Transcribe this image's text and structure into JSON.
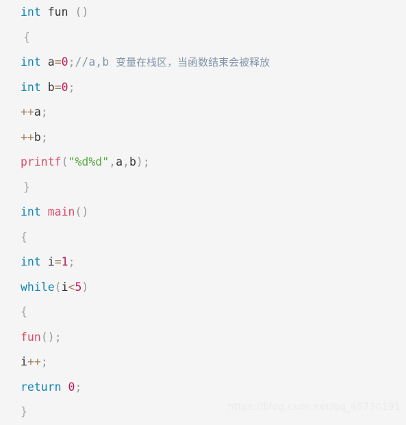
{
  "editor": {
    "background_color": "#f5f5f5",
    "language": "c",
    "line_count": 16
  },
  "theme": {
    "keyword_color": "#0e84b5",
    "function_color": "#dd4a68",
    "identifier_color": "#333333",
    "number_color": "#c2185b",
    "string_color": "#5caa42",
    "operator_color": "#a67f59",
    "punctuation_color": "#999999",
    "brace_color": "#aaaaaa",
    "comment_color": "#8494a8",
    "watermark_color": "#ebebeb"
  },
  "watermark": {
    "text": "https://blog.csdn.net/qq_45730191"
  },
  "code": {
    "lines": [
      {
        "number": 1,
        "indent": 0,
        "text": "int fun ()",
        "tokens": [
          {
            "t": "int",
            "c": "keyword"
          },
          {
            "t": " ",
            "c": "plain"
          },
          {
            "t": "fun",
            "c": "funcdef"
          },
          {
            "t": " ",
            "c": "plain"
          },
          {
            "t": "(",
            "c": "punct"
          },
          {
            "t": ")",
            "c": "punct"
          }
        ]
      },
      {
        "number": 2,
        "indent": 1,
        "text": "{",
        "tokens": [
          {
            "t": "{",
            "c": "brace"
          }
        ]
      },
      {
        "number": 3,
        "indent": 0,
        "text": "int a=0;//a,b 变量在栈区，当函数结束会被释放",
        "tokens": [
          {
            "t": "int",
            "c": "keyword"
          },
          {
            "t": " ",
            "c": "plain"
          },
          {
            "t": "a",
            "c": "ident"
          },
          {
            "t": "=",
            "c": "operator"
          },
          {
            "t": "0",
            "c": "number"
          },
          {
            "t": ";",
            "c": "punct"
          },
          {
            "t": "//a,b ",
            "c": "comment"
          },
          {
            "t": "变量在栈区，当函数结束会被释放",
            "c": "comment-cjk"
          }
        ]
      },
      {
        "number": 4,
        "indent": 0,
        "text": "int b=0;",
        "tokens": [
          {
            "t": "int",
            "c": "keyword"
          },
          {
            "t": " ",
            "c": "plain"
          },
          {
            "t": "b",
            "c": "ident"
          },
          {
            "t": "=",
            "c": "operator"
          },
          {
            "t": "0",
            "c": "number"
          },
          {
            "t": ";",
            "c": "punct"
          }
        ]
      },
      {
        "number": 5,
        "indent": 0,
        "text": "++a;",
        "tokens": [
          {
            "t": "++",
            "c": "operator"
          },
          {
            "t": "a",
            "c": "ident"
          },
          {
            "t": ";",
            "c": "punct"
          }
        ]
      },
      {
        "number": 6,
        "indent": 0,
        "text": "++b;",
        "tokens": [
          {
            "t": "++",
            "c": "operator"
          },
          {
            "t": "b",
            "c": "ident"
          },
          {
            "t": ";",
            "c": "punct"
          }
        ]
      },
      {
        "number": 7,
        "indent": 0,
        "text": "printf(\"%d%d\",a,b);",
        "tokens": [
          {
            "t": "printf",
            "c": "func"
          },
          {
            "t": "(",
            "c": "punct"
          },
          {
            "t": "\"%d%d\"",
            "c": "string"
          },
          {
            "t": ",",
            "c": "punct"
          },
          {
            "t": "a",
            "c": "ident"
          },
          {
            "t": ",",
            "c": "punct"
          },
          {
            "t": "b",
            "c": "ident"
          },
          {
            "t": ")",
            "c": "punct"
          },
          {
            "t": ";",
            "c": "punct"
          }
        ]
      },
      {
        "number": 8,
        "indent": 1,
        "text": "}",
        "tokens": [
          {
            "t": "}",
            "c": "brace"
          }
        ]
      },
      {
        "number": 9,
        "indent": 0,
        "text": "int main()",
        "tokens": [
          {
            "t": "int",
            "c": "keyword"
          },
          {
            "t": " ",
            "c": "plain"
          },
          {
            "t": "main",
            "c": "func"
          },
          {
            "t": "(",
            "c": "punct"
          },
          {
            "t": ")",
            "c": "punct"
          }
        ]
      },
      {
        "number": 10,
        "indent": 0,
        "text": "{",
        "tokens": [
          {
            "t": "{",
            "c": "brace"
          }
        ]
      },
      {
        "number": 11,
        "indent": 0,
        "text": "int i=1;",
        "tokens": [
          {
            "t": "int",
            "c": "keyword"
          },
          {
            "t": " ",
            "c": "plain"
          },
          {
            "t": "i",
            "c": "ident"
          },
          {
            "t": "=",
            "c": "operator"
          },
          {
            "t": "1",
            "c": "number"
          },
          {
            "t": ";",
            "c": "punct"
          }
        ]
      },
      {
        "number": 12,
        "indent": 0,
        "text": "while(i<5)",
        "tokens": [
          {
            "t": "while",
            "c": "keyword"
          },
          {
            "t": "(",
            "c": "punct"
          },
          {
            "t": "i",
            "c": "ident"
          },
          {
            "t": "<",
            "c": "operator"
          },
          {
            "t": "5",
            "c": "number"
          },
          {
            "t": ")",
            "c": "punct"
          }
        ]
      },
      {
        "number": 13,
        "indent": 0,
        "text": "{",
        "tokens": [
          {
            "t": "{",
            "c": "brace"
          }
        ]
      },
      {
        "number": 14,
        "indent": 0,
        "text": "fun();",
        "tokens": [
          {
            "t": "fun",
            "c": "func"
          },
          {
            "t": "(",
            "c": "punct"
          },
          {
            "t": ")",
            "c": "punct"
          },
          {
            "t": ";",
            "c": "punct"
          }
        ]
      },
      {
        "number": 15,
        "indent": 0,
        "text": "i++;",
        "tokens": [
          {
            "t": "i",
            "c": "ident"
          },
          {
            "t": "++",
            "c": "operator"
          },
          {
            "t": ";",
            "c": "punct"
          }
        ]
      },
      {
        "number": 16,
        "indent": 0,
        "text": "return 0;",
        "tokens": [
          {
            "t": "return",
            "c": "keyword"
          },
          {
            "t": " ",
            "c": "plain"
          },
          {
            "t": "0",
            "c": "number"
          },
          {
            "t": ";",
            "c": "punct"
          }
        ]
      },
      {
        "number": 17,
        "indent": 0,
        "text": "}",
        "tokens": [
          {
            "t": "}",
            "c": "brace"
          }
        ]
      }
    ]
  }
}
